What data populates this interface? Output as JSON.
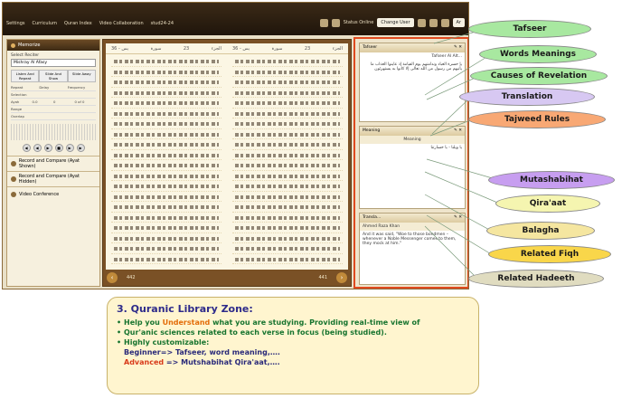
{
  "topbar": {
    "menu": [
      "Settings",
      "Curriculum",
      "Quran Index",
      "Video Collaboration",
      "stud24-24"
    ],
    "status": "Status Online",
    "change_user": "Change User",
    "ar_label": "Ar"
  },
  "left_panel": {
    "memorize": "Memorize",
    "select_reciter": "Select Reciter",
    "reciter": "Mishray Al Afasy",
    "tabs": [
      "Listen And Repeat",
      "Slide And Show",
      "Slide Away"
    ],
    "grid_headers": [
      "Repeat",
      "Delay",
      "Frequency"
    ],
    "rows": [
      "Selection",
      "Ayah",
      "Range",
      "Overlap"
    ],
    "ayah_values": [
      "0.0",
      "0",
      "0 of 0"
    ],
    "sections": [
      "Record and Compare (Ayat Shown)",
      "Record and Compare (Ayat Hidden)",
      "Video Conference"
    ]
  },
  "book": {
    "left_header": [
      "يس - 36",
      "سورة",
      "23",
      "الجزء"
    ],
    "right_header": [
      "يس - 36",
      "سورة",
      "23",
      "الجزء"
    ],
    "left_page": "442",
    "right_page": "441"
  },
  "library": {
    "tafseer_tab": "Tafseer",
    "tafseer_title": "Tafseer Al Alt...",
    "tafseer_text": "يا حسرة العباد وندامتهم يوم القيامة إذ عاينوا العذاب ما يأتيهم من رسول من الله تعالى إلا كانوا به يستهزئون",
    "meaning_tab": "Meaning",
    "meaning_col": "Meaning",
    "meaning_word": "يا ويلنا",
    "meaning_text": "يا ويلنا - يا خسارتنا",
    "transl_tab": "Transla...",
    "transl_author": "Ahmed Raza Khan",
    "transl_text": "And it was said, \"Woe to those bondmen – whenever a Noble Messenger comes to them, they mock at him.\""
  },
  "callouts": {
    "c1": "Tafseer",
    "c2": "Words Meanings",
    "c3": "Causes of Revelation",
    "c4": "Translation",
    "c5": "Tajweed Rules",
    "c6": "Mutashabihat",
    "c7": "Qira'aat",
    "c8": "Balagha",
    "c9": "Related Fiqh",
    "c10": "Related Hadeeth"
  },
  "info": {
    "title": "3. Quranic Library Zone:",
    "l1a": "Help you ",
    "l1b": "Understand",
    "l1c": " what you are studying. Providing real-time view of",
    "l2": "Qur'anic sciences related to each verse in focus (being studied).",
    "l3": "Highly customizable:",
    "l4": "Beginner=> Tafseer, word meaning,….",
    "l5a": "Advanced",
    "l5b": " => Mutshabihat Qira'aat,…."
  },
  "colors": {
    "tafseer": "#a8e8a0",
    "words": "#a8e8a0",
    "causes": "#a8e8a0",
    "translation": "#d7c8f2",
    "tajweed": "#f8a874",
    "mutashabihat": "#c79ef0",
    "qiraat": "#f5f5b0",
    "balagha": "#f5e6a0",
    "fiqh": "#f9d64a",
    "hadeeth": "#e0dcc0",
    "zone_border": "#e04a1f"
  }
}
